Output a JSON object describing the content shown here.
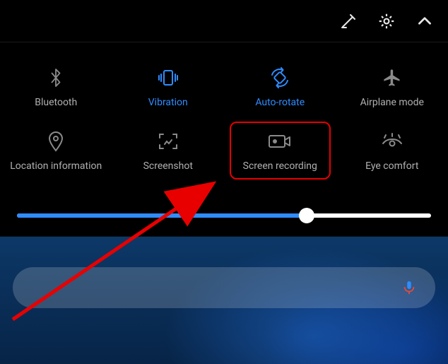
{
  "topbar": {
    "edit_icon": "edit-icon",
    "settings_icon": "settings-icon",
    "expand_icon": "chevron-up-icon"
  },
  "tiles": [
    {
      "id": "bluetooth",
      "label": "Bluetooth",
      "active": false
    },
    {
      "id": "vibration",
      "label": "Vibration",
      "active": true
    },
    {
      "id": "auto-rotate",
      "label": "Auto-rotate",
      "active": true
    },
    {
      "id": "airplane-mode",
      "label": "Airplane mode",
      "active": false
    },
    {
      "id": "location",
      "label": "Location information",
      "active": false
    },
    {
      "id": "screenshot",
      "label": "Screenshot",
      "active": false
    },
    {
      "id": "screen-recording",
      "label": "Screen recording",
      "active": false,
      "highlighted": true
    },
    {
      "id": "eye-comfort",
      "label": "Eye comfort",
      "active": false
    }
  ],
  "brightness": {
    "value_percent": 70
  },
  "search": {
    "mic_icon": "mic-icon"
  },
  "colors": {
    "accent": "#2f8cff",
    "highlight": "#e80000",
    "icon_inactive": "#8a8a8a",
    "text_inactive": "#b0b0b0"
  }
}
